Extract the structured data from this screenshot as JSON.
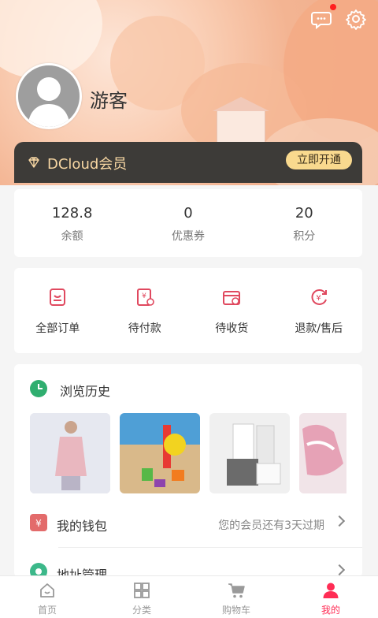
{
  "profile": {
    "username": "游客"
  },
  "vip": {
    "title": "DCloud会员",
    "button": "立即开通"
  },
  "stats": [
    {
      "value": "128.8",
      "label": "余额"
    },
    {
      "value": "0",
      "label": "优惠券"
    },
    {
      "value": "20",
      "label": "积分"
    }
  ],
  "orders": [
    {
      "label": "全部订单",
      "icon": "order-list-icon"
    },
    {
      "label": "待付款",
      "icon": "pending-payment-icon"
    },
    {
      "label": "待收货",
      "icon": "pending-receipt-icon"
    },
    {
      "label": "退款/售后",
      "icon": "refund-icon"
    }
  ],
  "history": {
    "title": "浏览历史"
  },
  "wallet": {
    "title": "我的钱包",
    "tip": "您的会员还有3天过期"
  },
  "address": {
    "title": "地址管理"
  },
  "tabs": [
    {
      "label": "首页",
      "icon": "home-icon"
    },
    {
      "label": "分类",
      "icon": "category-icon"
    },
    {
      "label": "购物车",
      "icon": "cart-icon"
    },
    {
      "label": "我的",
      "icon": "user-icon"
    }
  ],
  "colors": {
    "accent": "#ff2d55",
    "vip_gold": "#f8d7a3",
    "vip_bar": "#3d3b38",
    "icon_pink": "#e0495f"
  }
}
